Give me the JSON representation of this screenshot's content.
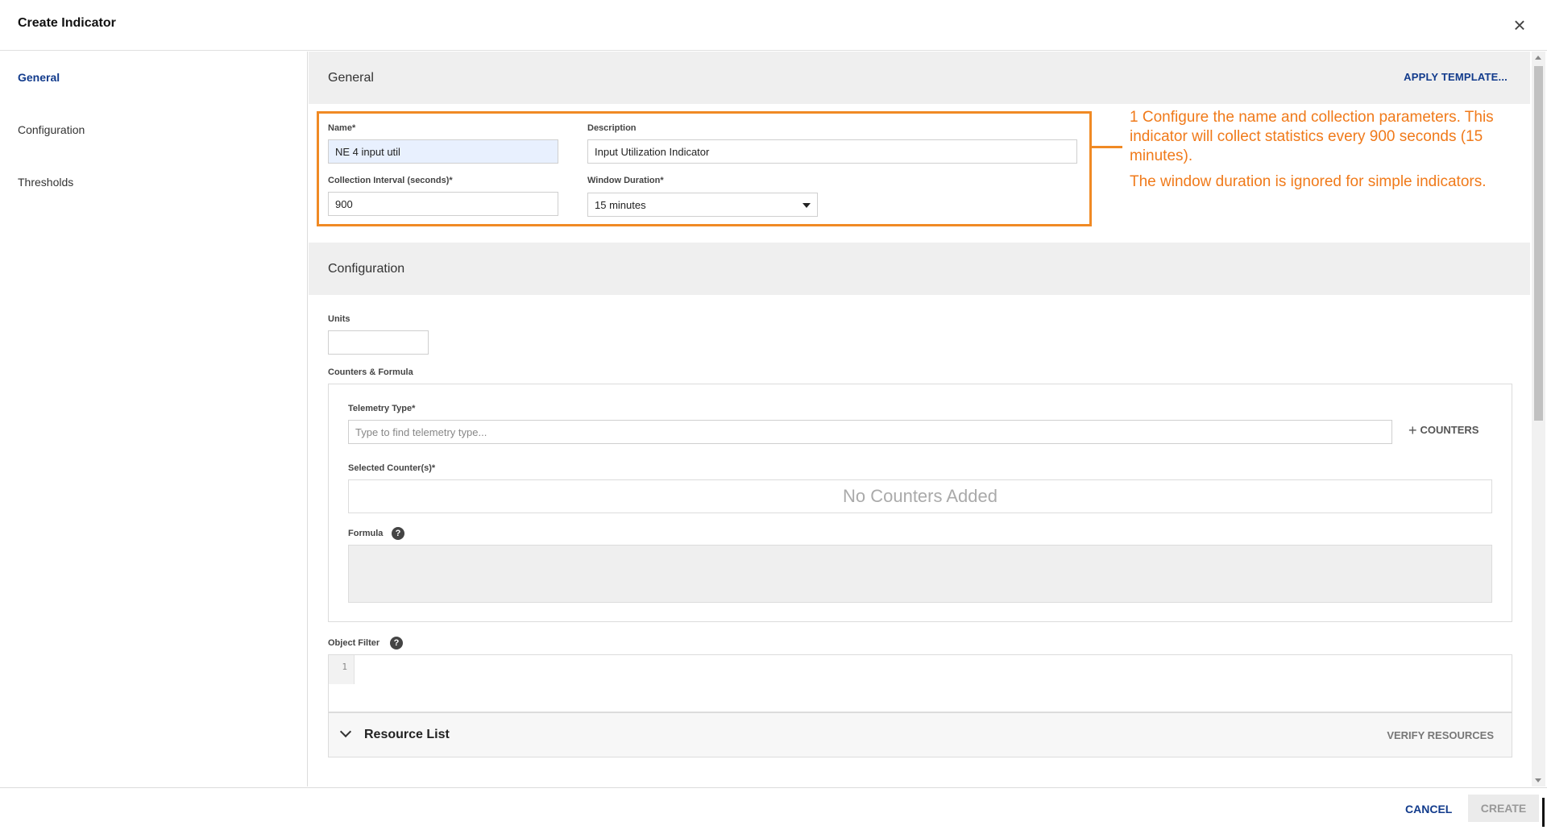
{
  "dialog": {
    "title": "Create Indicator",
    "close_glyph": "×"
  },
  "sidebar": {
    "items": [
      {
        "label": "General",
        "active": true
      },
      {
        "label": "Configuration",
        "active": false
      },
      {
        "label": "Thresholds",
        "active": false
      }
    ]
  },
  "general": {
    "heading": "General",
    "apply_template": "APPLY TEMPLATE...",
    "name_label": "Name*",
    "name_value": "NE 4 input util",
    "description_label": "Description",
    "description_value": "Input Utilization Indicator",
    "interval_label": "Collection Interval (seconds)*",
    "interval_value": "900",
    "window_label": "Window Duration*",
    "window_value": "15 minutes"
  },
  "annotation": {
    "line1": "1 Configure the name and collection parameters. This indicator will collect statistics every 900 seconds (15 minutes).",
    "line2": "The window duration is ignored for simple indicators.",
    "color": "#f07a1a"
  },
  "configuration": {
    "heading": "Configuration",
    "units_label": "Units",
    "units_value": "",
    "counters_formula_label": "Counters & Formula",
    "telemetry_label": "Telemetry Type*",
    "telemetry_placeholder": "Type to find telemetry type...",
    "add_counters": "COUNTERS",
    "selected_counters_label": "Selected Counter(s)*",
    "no_counters": "No Counters Added",
    "formula_label": "Formula",
    "object_filter_label": "Object Filter",
    "filter_line_number": "1",
    "resource_list": "Resource List",
    "verify_resources": "VERIFY RESOURCES"
  },
  "footer": {
    "cancel": "CANCEL",
    "create": "CREATE"
  },
  "colors": {
    "accent": "#123b8c",
    "highlight": "#f08a24"
  },
  "icons": {
    "close": "close-icon",
    "help": "help-icon",
    "plus": "plus-icon",
    "chevron": "chevron-down-icon",
    "caret": "caret-down-icon"
  }
}
